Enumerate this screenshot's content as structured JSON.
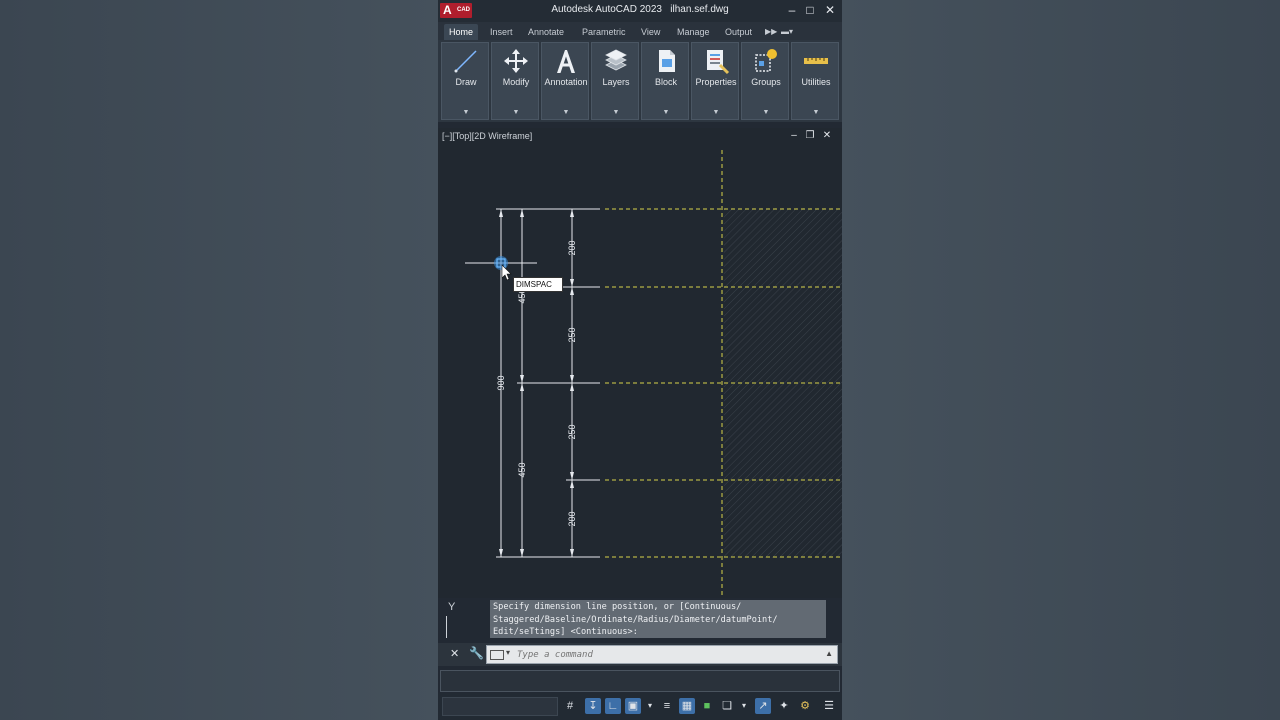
{
  "app": {
    "title": "Autodesk AutoCAD 2023",
    "filename": "ilhan.sef.dwg",
    "logo_letter": "A",
    "logo_suffix": "CAD"
  },
  "ribbon_tabs": [
    "Home",
    "Insert",
    "Annotate",
    "Parametric",
    "View",
    "Manage",
    "Output"
  ],
  "ribbon_panels": [
    {
      "label": "Draw",
      "icon": "line-icon"
    },
    {
      "label": "Modify",
      "icon": "move-icon"
    },
    {
      "label": "Annotation",
      "icon": "text-a-icon"
    },
    {
      "label": "Layers",
      "icon": "layers-icon"
    },
    {
      "label": "Block",
      "icon": "block-icon"
    },
    {
      "label": "Properties",
      "icon": "properties-icon"
    },
    {
      "label": "Groups",
      "icon": "groups-icon"
    },
    {
      "label": "Utilities",
      "icon": "measure-icon"
    }
  ],
  "viewport": {
    "label": "[−][Top][2D Wireframe]"
  },
  "dimensions": {
    "right_chain": [
      "200",
      "250",
      "250",
      "200"
    ],
    "middle_chain": [
      "450",
      "450"
    ],
    "overall": "900"
  },
  "dynamic_input": {
    "value": "DIMSPAC"
  },
  "ucs": {
    "axis": "Y"
  },
  "command": {
    "history": [
      "Specify dimension line position, or [Continuous/",
      "Staggered/Baseline/Ordinate/Radius/Diameter/datumPoint/",
      "Edit/seTtings] <Continuous>:"
    ],
    "placeholder": "Type a command"
  },
  "colors": {
    "accent": "#b01e2d",
    "grid_yellow": "#d8d24a",
    "dim_white": "#e6e9ee",
    "status_on": "#3d6fa8"
  }
}
